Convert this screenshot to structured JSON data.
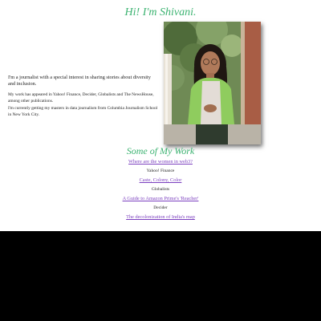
{
  "hero": {
    "title": "Hi! I'm Shivani."
  },
  "intro": {
    "lead": "I'm a journalist with a special interest in sharing stories about diversity and inclusion.",
    "body": [
      "My work has appeared in Yahoo! Finance, Decider, Globalists and The NewsHouse, among other publications.",
      "I'm currently getting my masters in data journalism from Columbia Journalism School in New York City."
    ]
  },
  "work": {
    "title": "Some of My Work",
    "items": [
      {
        "link": "Where are the women in web3?",
        "publication": "Yahoo! Finance"
      },
      {
        "link": "Caste, Colony, Color",
        "publication": "Globalists"
      },
      {
        "link": "A Guide to Amazon Prime's 'Reacher'",
        "publication": "Decider"
      },
      {
        "link": "The decolonization of India's map",
        "publication": ""
      }
    ]
  },
  "colors": {
    "heading": "#3cb371",
    "link": "#7b3fbf",
    "below_page": "#000000"
  }
}
